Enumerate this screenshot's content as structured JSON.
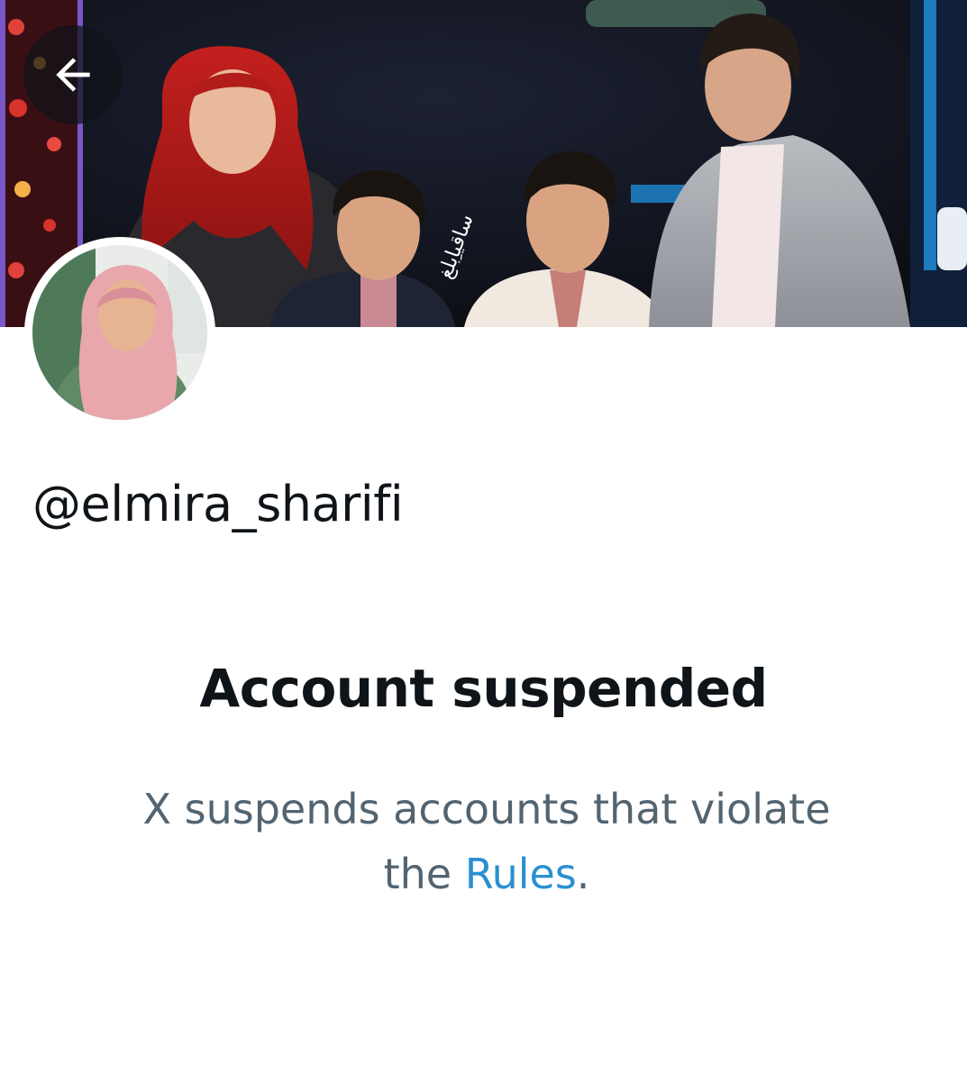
{
  "header": {
    "back_label": "Back",
    "banner_watermark": "ساقیاِبلغ"
  },
  "profile": {
    "handle": "@elmira_sharifi"
  },
  "suspension": {
    "title": "Account suspended",
    "description_line1": "X suspends accounts that violate",
    "description_prefix": "the ",
    "rules_link_label": "Rules",
    "description_suffix": "."
  },
  "colors": {
    "text_primary": "#0f1419",
    "text_secondary": "#536471",
    "link": "#2b8fd1",
    "background": "#ffffff"
  },
  "icons": {
    "back": "arrow-left-icon"
  }
}
